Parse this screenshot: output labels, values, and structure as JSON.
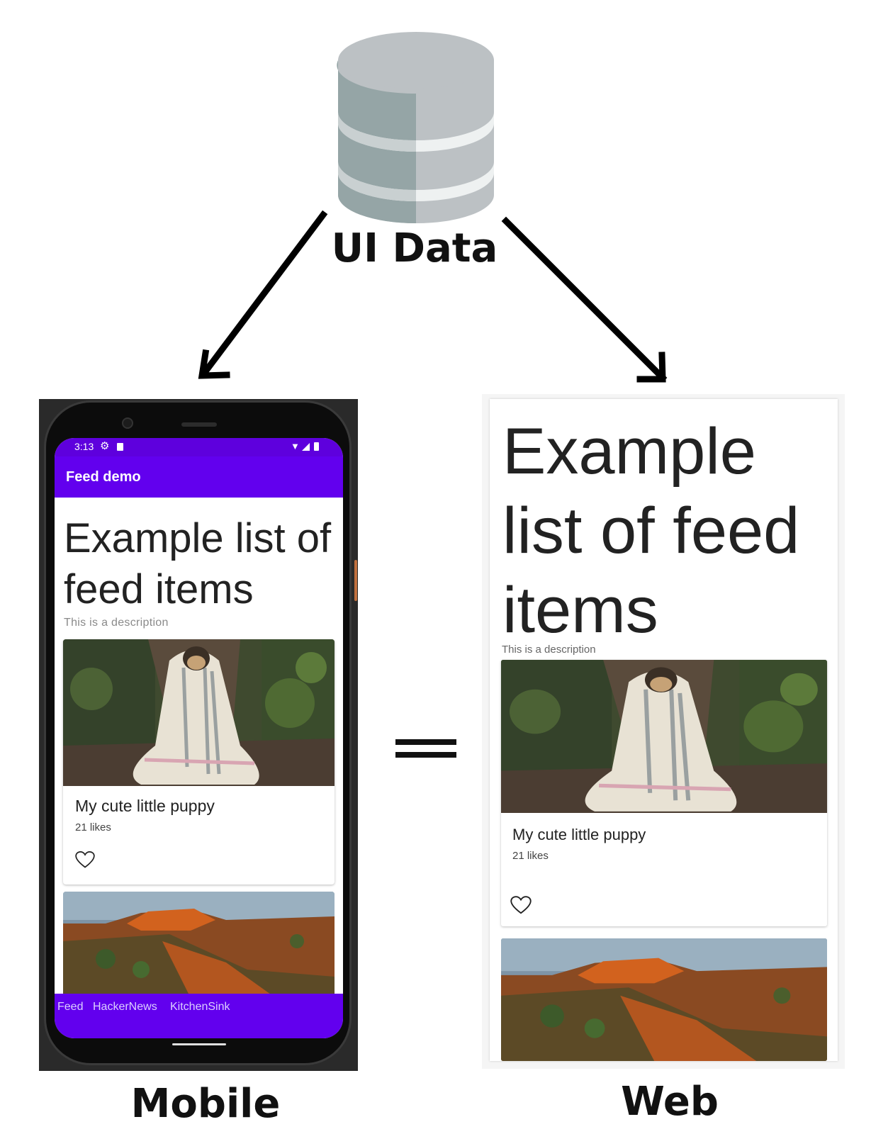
{
  "diagram": {
    "source_label": "UI Data",
    "equals_sign": "==",
    "mobile_caption": "Mobile",
    "web_caption": "Web"
  },
  "mobile": {
    "status_bar": {
      "time": "3:13"
    },
    "app_bar_title": "Feed demo",
    "headline": "Example list of feed items",
    "description": "This is a description",
    "card": {
      "title": "My cute little puppy",
      "likes": "21 likes"
    },
    "bottom_nav": [
      "Feed",
      "HackerNews",
      "KitchenSink"
    ]
  },
  "web": {
    "headline": "Example list of feed items",
    "description": "This is a description",
    "card": {
      "title": "My cute little puppy",
      "likes": "21 likes"
    }
  },
  "colors": {
    "app_bar": "#6200ee",
    "status_bar": "#5e00dd",
    "database_light": "#bcc1c4",
    "database_dark": "#95a5a6"
  },
  "icons": [
    "database-icon",
    "heart-icon",
    "settings-gear-icon",
    "sd-card-icon",
    "wifi-icon",
    "signal-icon",
    "battery-icon"
  ]
}
